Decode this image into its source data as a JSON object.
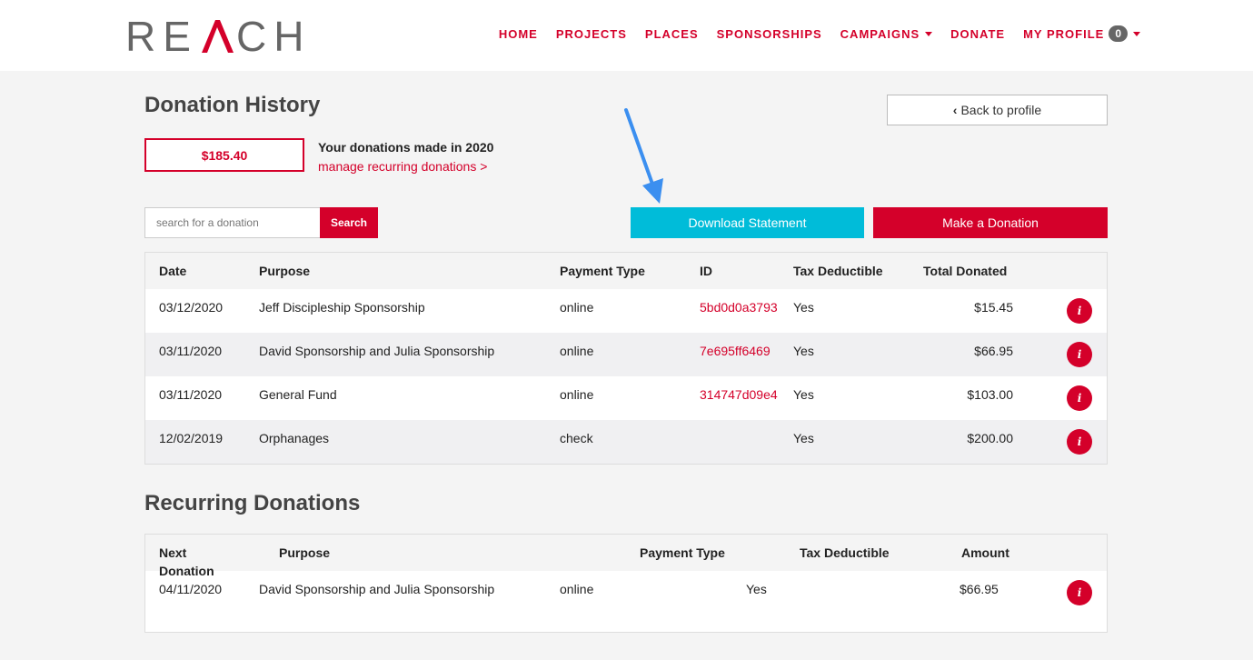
{
  "brand": {
    "logo_text": "REACH",
    "accent": "#d4002a"
  },
  "nav": {
    "home": "HOME",
    "projects": "PROJECTS",
    "places": "PLACES",
    "sponsorships": "SPONSORSHIPS",
    "campaigns": "CAMPAIGNS",
    "donate": "DONATE",
    "profile": "MY PROFILE",
    "profile_badge": "0"
  },
  "page": {
    "title": "Donation History",
    "back_label": "Back to profile",
    "total_amount": "$185.40",
    "total_caption": "Your donations made in 2020",
    "manage_link": "manage recurring donations >",
    "search_placeholder": "search for a donation",
    "search_label": "Search",
    "download_label": "Download Statement",
    "donate_label": "Make a Donation"
  },
  "history": {
    "headers": {
      "date": "Date",
      "purpose": "Purpose",
      "payment": "Payment Type",
      "id": "ID",
      "tax": "Tax Deductible",
      "total": "Total Donated"
    },
    "rows": [
      {
        "date": "03/12/2020",
        "purpose": "Jeff Discipleship Sponsorship",
        "payment": "online",
        "id": "5bd0d0a3793",
        "tax": "Yes",
        "total": "$15.45"
      },
      {
        "date": "03/11/2020",
        "purpose": "David Sponsorship and Julia Sponsorship",
        "payment": "online",
        "id": "7e695ff6469",
        "tax": "Yes",
        "total": "$66.95"
      },
      {
        "date": "03/11/2020",
        "purpose": "General Fund",
        "payment": "online",
        "id": "314747d09e4",
        "tax": "Yes",
        "total": "$103.00"
      },
      {
        "date": "12/02/2019",
        "purpose": "Orphanages",
        "payment": "check",
        "id": "",
        "tax": "Yes",
        "total": "$200.00"
      }
    ]
  },
  "recurring": {
    "title": "Recurring Donations",
    "headers": {
      "next_line1": "Next",
      "next_line2": "Donation",
      "purpose": "Purpose",
      "payment": "Payment Type",
      "tax": "Tax Deductible",
      "amount": "Amount"
    },
    "rows": [
      {
        "next": "04/11/2020",
        "purpose": "David Sponsorship and Julia Sponsorship",
        "payment": "online",
        "tax": "Yes",
        "amount": "$66.95"
      }
    ]
  },
  "icons": {
    "info": "info-icon",
    "back": "chevron-left-icon",
    "annotation": "arrow-annotation-icon"
  }
}
